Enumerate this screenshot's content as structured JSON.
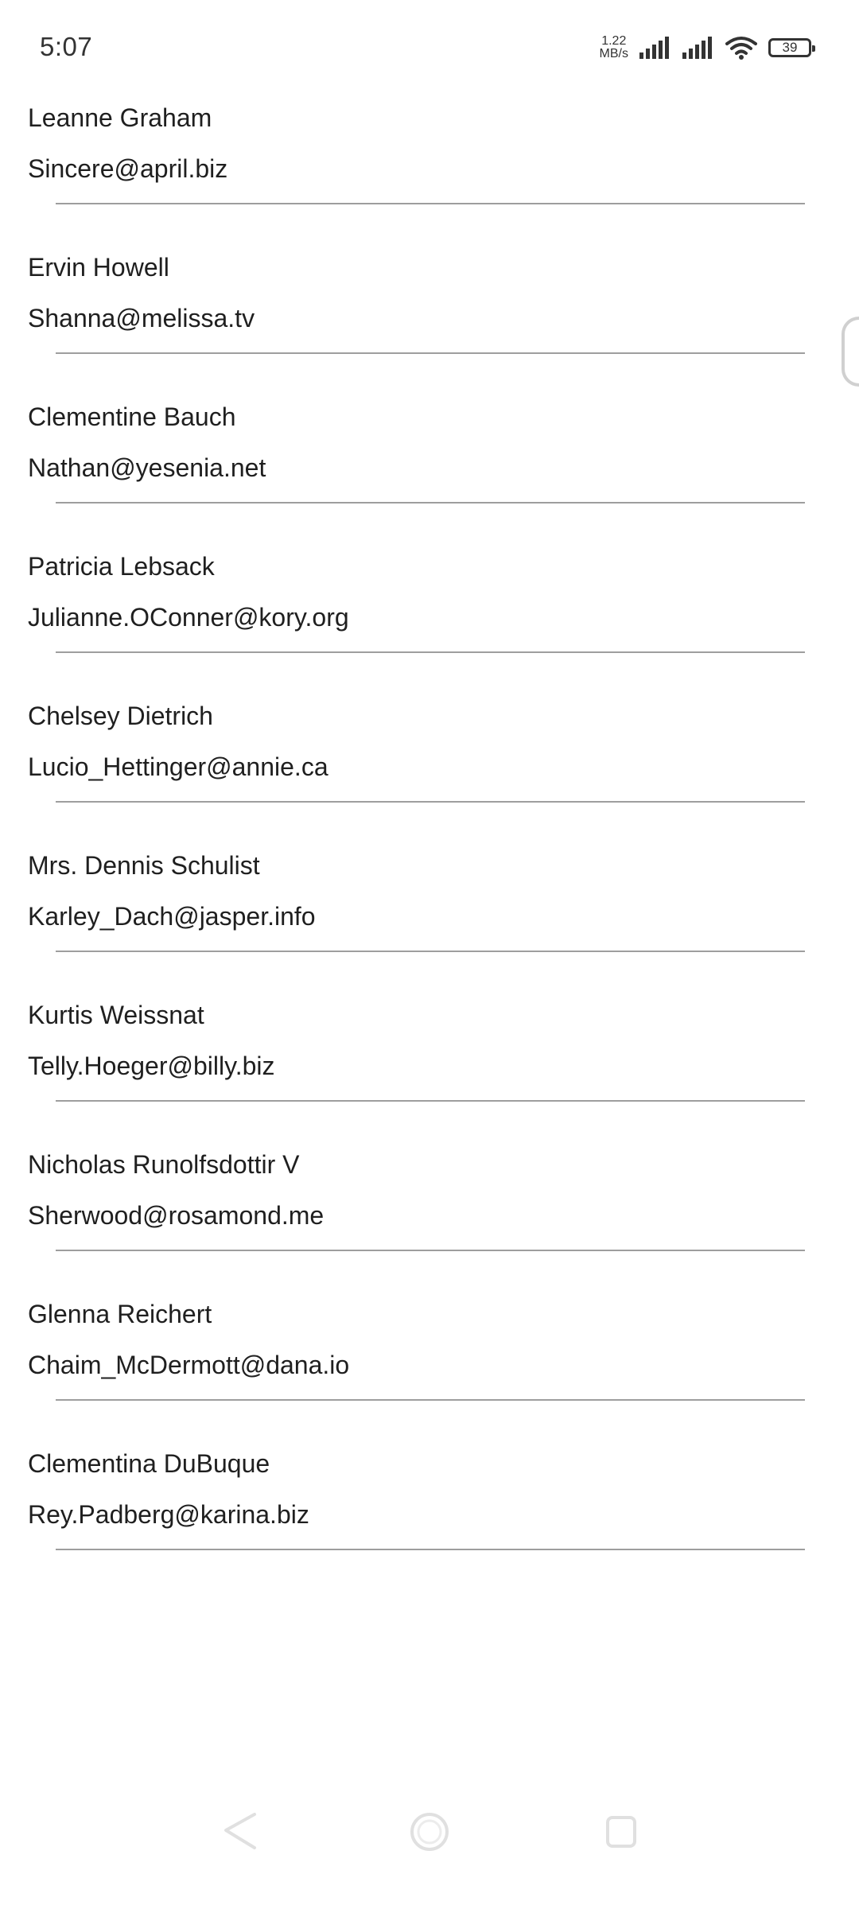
{
  "status_bar": {
    "time": "5:07",
    "net_speed_value": "1.22",
    "net_speed_unit": "MB/s",
    "battery_level": "39",
    "icons": [
      "signal-icon",
      "signal-icon",
      "wifi-icon",
      "battery-icon"
    ]
  },
  "users": [
    {
      "name": "Leanne Graham",
      "email": "Sincere@april.biz"
    },
    {
      "name": "Ervin Howell",
      "email": "Shanna@melissa.tv"
    },
    {
      "name": "Clementine Bauch",
      "email": "Nathan@yesenia.net"
    },
    {
      "name": "Patricia Lebsack",
      "email": "Julianne.OConner@kory.org"
    },
    {
      "name": "Chelsey Dietrich",
      "email": "Lucio_Hettinger@annie.ca"
    },
    {
      "name": "Mrs. Dennis Schulist",
      "email": "Karley_Dach@jasper.info"
    },
    {
      "name": "Kurtis Weissnat",
      "email": "Telly.Hoeger@billy.biz"
    },
    {
      "name": "Nicholas Runolfsdottir V",
      "email": "Sherwood@rosamond.me"
    },
    {
      "name": "Glenna Reichert",
      "email": "Chaim_McDermott@dana.io"
    },
    {
      "name": "Clementina DuBuque",
      "email": "Rey.Padberg@karina.biz"
    }
  ],
  "nav_bar": {
    "icons": [
      "back-icon",
      "home-icon",
      "recents-icon"
    ]
  },
  "colors": {
    "background": "#ffffff",
    "text": "#1f1f1f",
    "divider": "#9e9e9e",
    "nav_icon": "#e0e0e0"
  }
}
